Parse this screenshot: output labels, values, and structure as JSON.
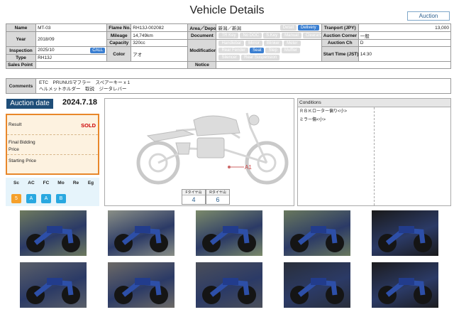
{
  "header": {
    "title": "Vehicle Details",
    "auction_button": "Auction"
  },
  "vehicle": {
    "name_label": "Name",
    "name": "MT-03",
    "frame_label": "Flame No.",
    "frame": "RH13J-002082",
    "area_label": "Area／Depot",
    "area": "新潟／新潟",
    "transport_label": "Tranport (JPY)",
    "transport": "13,000",
    "year_label": "Year",
    "year": "2018/09",
    "mileage_label": "Mileage",
    "mileage": "14,749km",
    "document_label": "Document",
    "corner_label": "Auction Corner",
    "corner": "一般",
    "capacity_label": "Capacity",
    "capacity": "320cc",
    "channel_label": "Auction Ch",
    "channel": "D",
    "inspection_label": "Inspection",
    "inspection": "2025/10",
    "call": "CALL",
    "color_label": "Color",
    "color": "アオ",
    "modification_label": "Modification",
    "start_label": "Start Time (JST)",
    "start": "14:30",
    "type_label": "Type",
    "type": "RH13J",
    "sales_point_label": "Sales Point",
    "sales_point": "",
    "notice_label": "Notice",
    "notice": ""
  },
  "area_badges": [
    {
      "label": "Detail",
      "active": false
    },
    {
      "label": "Delivery",
      "active": true
    }
  ],
  "document_badges": [
    {
      "label": "TR Key",
      "active": false
    },
    {
      "label": "No DOC",
      "active": false
    },
    {
      "label": "S.Key",
      "active": false
    },
    {
      "label": "Manual",
      "active": false
    },
    {
      "label": "Clearance",
      "active": false
    }
  ],
  "modification_badges": [
    {
      "label": "Handlebar",
      "active": false
    },
    {
      "label": "Mirror",
      "active": false
    },
    {
      "label": "Blinker",
      "active": false
    },
    {
      "label": "Meter",
      "active": false
    },
    {
      "label": "Rear Fender",
      "active": false
    },
    {
      "label": "Seat",
      "active": true
    },
    {
      "label": "Step",
      "active": false
    },
    {
      "label": "Muffler",
      "active": false
    },
    {
      "label": "Silencer",
      "active": false
    },
    {
      "label": "Rear Suspension",
      "active": false
    }
  ],
  "comments": {
    "label": "Comments",
    "line1": "ETC　PRUNUSマフラー　スペアーキー x 1",
    "line2": "ヘルメットホルダー　取説　ジータレバー"
  },
  "auction": {
    "date_label": "Auction date",
    "date": "2024.7.18",
    "result_label": "Result",
    "result": "SOLD",
    "final_bid_label_1": "Final Bidding",
    "final_bid_label_2": "Price",
    "final_bid": "",
    "starting_label": "Starting Price",
    "starting": ""
  },
  "grades": [
    {
      "label": "Sc",
      "value": "5",
      "color": "#f5a02a"
    },
    {
      "label": "AC",
      "value": "A",
      "color": "#29a8e0"
    },
    {
      "label": "FC",
      "value": "A",
      "color": "#29a8e0"
    },
    {
      "label": "Mo",
      "value": "B",
      "color": "#29a8e0"
    },
    {
      "label": "Re",
      "value": "",
      "color": ""
    },
    {
      "label": "Eg",
      "value": "",
      "color": ""
    }
  ],
  "diagram": {
    "damage_marker": "A1",
    "front_tire_label": "Fタイヤ山",
    "front_tire": "4",
    "rear_tire_label": "Rタイヤ山",
    "rear_tire": "6"
  },
  "conditions": {
    "header": "Conditions",
    "items": [
      "ＲＢＫローター偏り<小>",
      "ミラー傷<小>"
    ]
  },
  "photos": [
    {
      "name": "photo-front-left",
      "bg": "#6e7a5e"
    },
    {
      "name": "photo-rear-left",
      "bg": "#8a8f86"
    },
    {
      "name": "photo-right-side",
      "bg": "#7b8a6a"
    },
    {
      "name": "photo-front",
      "bg": "#69785d"
    },
    {
      "name": "photo-meter",
      "bg": "#1a1a1a"
    },
    {
      "name": "photo-engine-left",
      "bg": "#5a5f68"
    },
    {
      "name": "photo-fork",
      "bg": "#6d6a66"
    },
    {
      "name": "photo-swingarm",
      "bg": "#4b4f59"
    },
    {
      "name": "photo-under-seat",
      "bg": "#2a2f3a"
    },
    {
      "name": "photo-seat",
      "bg": "#1c1c1e"
    }
  ]
}
